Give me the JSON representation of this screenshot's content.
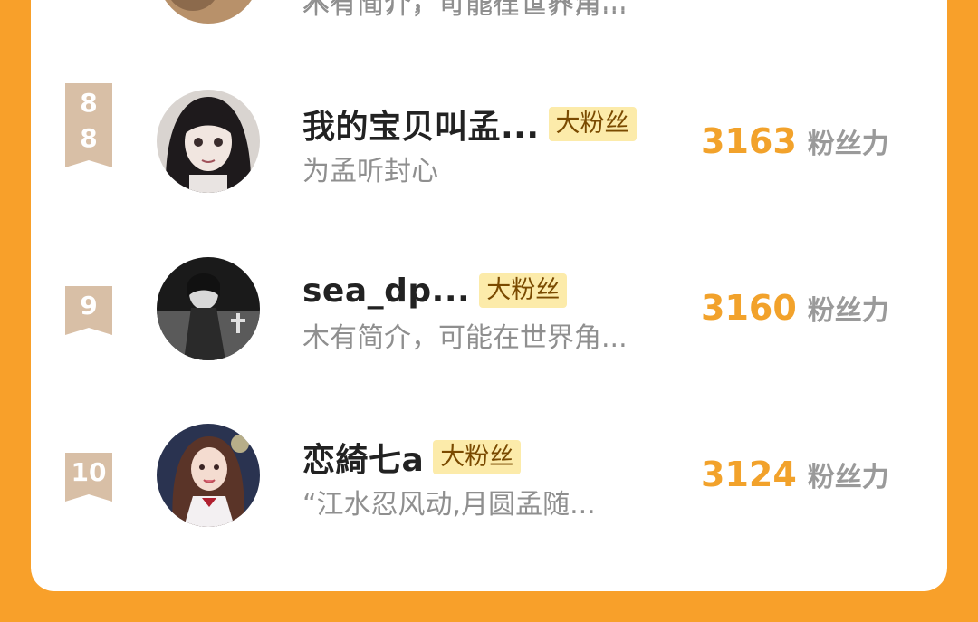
{
  "colors": {
    "background": "#F8A02A",
    "card": "#FFFFFF",
    "score": "#F2A22B",
    "badge_bg": "#FCEBAA",
    "rank_ribbon": "#D8BFA6"
  },
  "partial_row": {
    "bio": "木有简介，可能在世界角..."
  },
  "rows": [
    {
      "rank": "8",
      "name": "我的宝贝叫孟...",
      "badge": "大粉丝",
      "bio": "为孟听封心",
      "score": "3163",
      "unit": "粉丝力",
      "avatar_icon": "avatar-anime-girl-dark-hair"
    },
    {
      "rank": "9",
      "name": "sea_dp...",
      "badge": "大粉丝",
      "bio": "木有简介，可能在世界角...",
      "score": "3160",
      "unit": "粉丝力",
      "avatar_icon": "avatar-grayscale-figure"
    },
    {
      "rank": "10",
      "name": "恋綺七a",
      "badge": "大粉丝",
      "bio": "“江水忍风动,月圆孟随...",
      "score": "3124",
      "unit": "粉丝力",
      "avatar_icon": "avatar-girl-school-uniform"
    }
  ]
}
